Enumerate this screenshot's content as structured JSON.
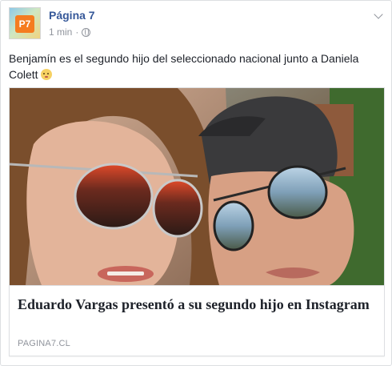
{
  "post": {
    "author": "Página 7",
    "avatar_text": "P7",
    "timestamp": "1 min",
    "separator": "·",
    "privacy_icon": "globe-icon",
    "menu_icon": "chevron-down-icon",
    "text": "Benjamín es el segundo hijo del seleccionado nacional junto a Daniela Colett",
    "emoji": "baby-emoji"
  },
  "link_card": {
    "headline": "Eduardo Vargas presentó a su segundo hijo en Instagram",
    "domain": "PAGINA7.CL",
    "image": "selfie-couple-sunglasses-photo"
  },
  "colors": {
    "link": "#365899",
    "meta": "#90949c",
    "text": "#1d2129",
    "border": "#dddfe2"
  }
}
